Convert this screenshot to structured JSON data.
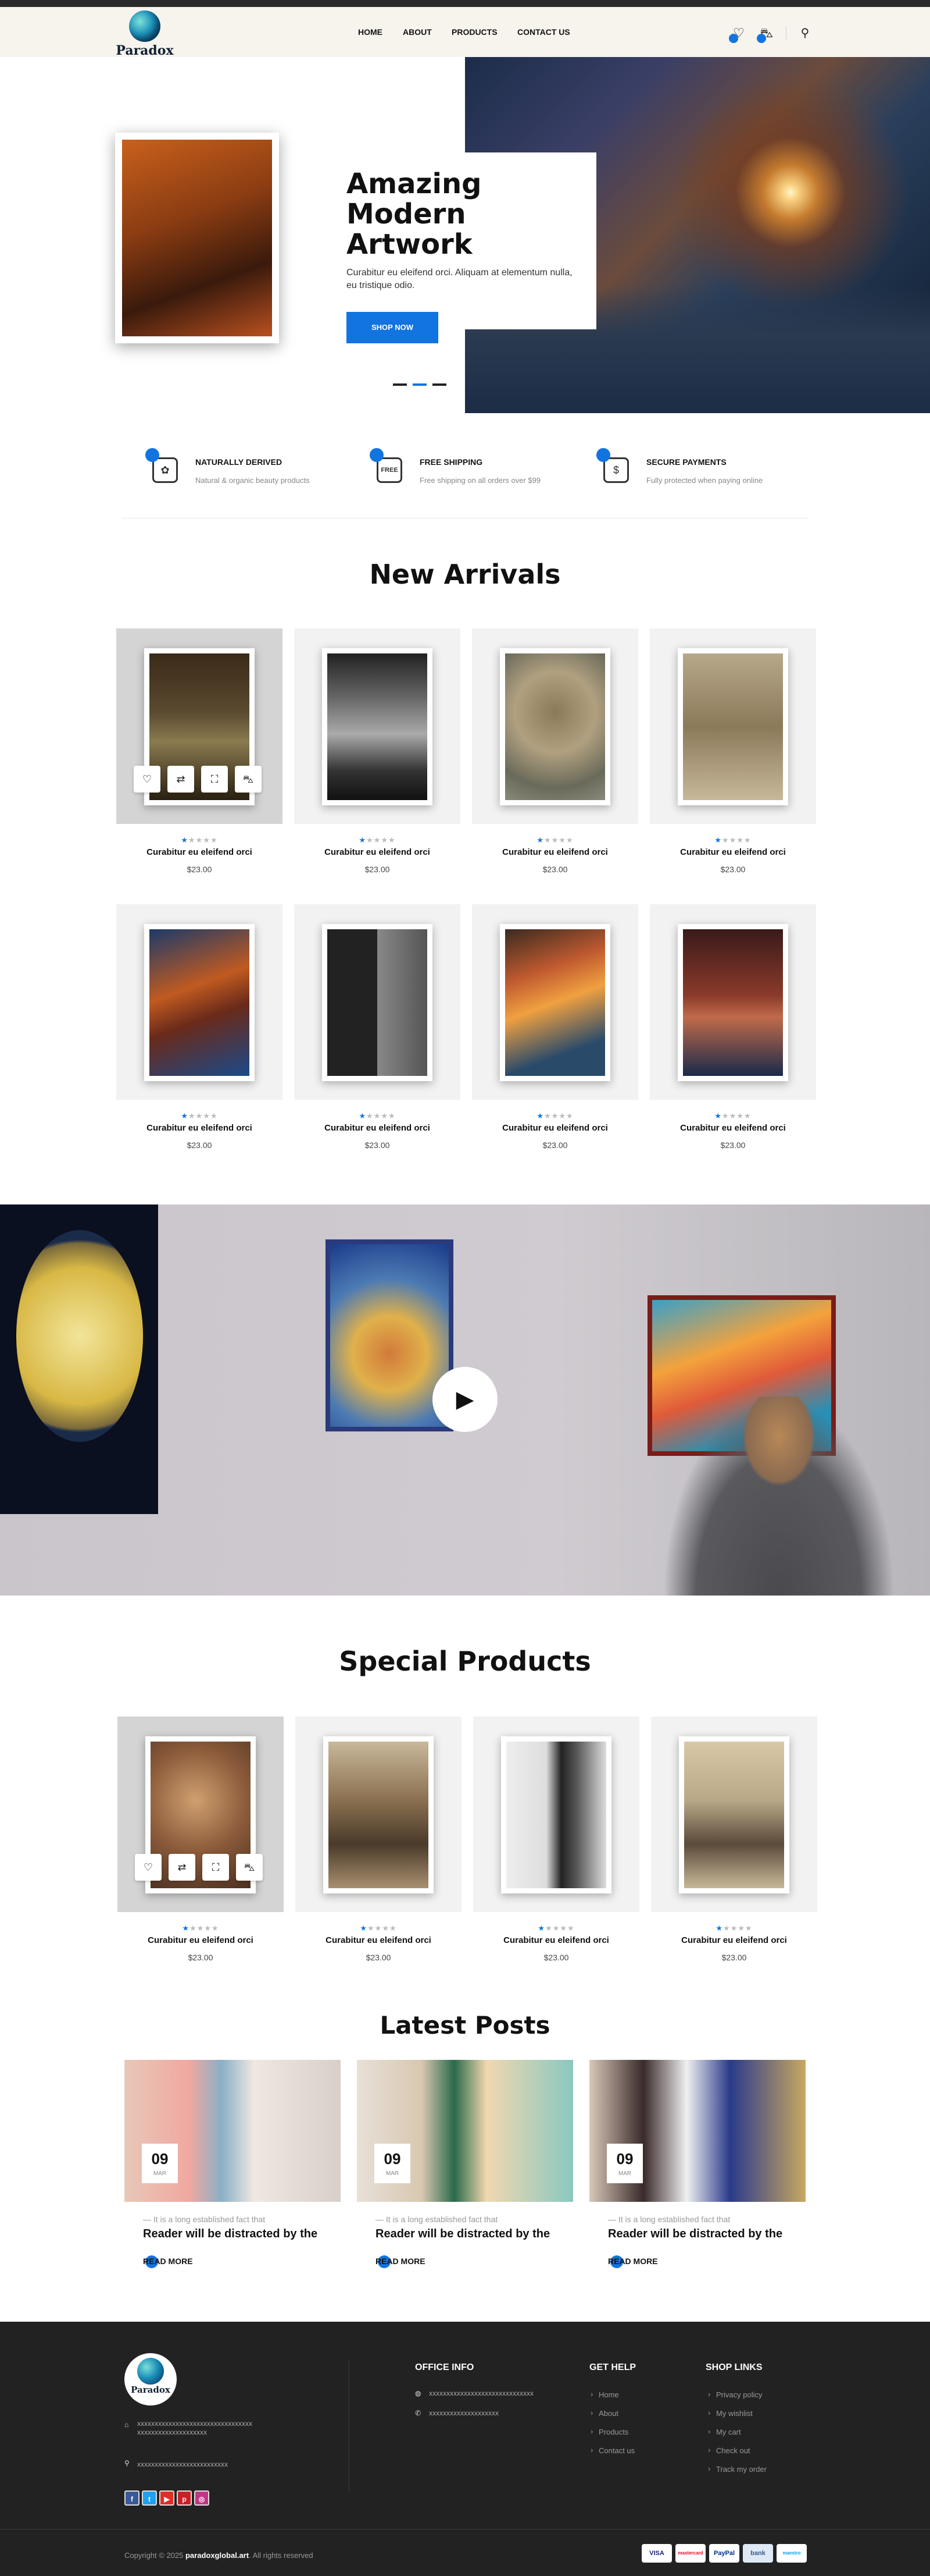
{
  "header": {
    "logo_text": "Paradox",
    "nav": [
      "HOME",
      "ABOUT",
      "PRODUCTS",
      "CONTACT US"
    ],
    "icons": [
      "wishlist-icon",
      "cart-icon",
      "search-icon"
    ]
  },
  "hero": {
    "title_line1": "Amazing",
    "title_line2": "Modern Artwork",
    "text": "Curabitur eu eleifend orci. Aliquam at elementum nulla, eu tristique odio.",
    "button": "SHOP NOW",
    "slide_count": 3,
    "active_slide": 2
  },
  "features": [
    {
      "title": "NATURALLY DERIVED",
      "subtitle": "Natural & organic beauty products",
      "icon": "natural-icon",
      "glyph": "✿"
    },
    {
      "title": "FREE SHIPPING",
      "subtitle": "Free shipping on all orders over $99",
      "icon": "truck-icon",
      "glyph": "FREE"
    },
    {
      "title": "SECURE PAYMENTS",
      "subtitle": "Fully protected when paying online",
      "icon": "secure-hand-icon",
      "glyph": "$"
    }
  ],
  "new_arrivals": {
    "title": "New Arrivals",
    "products": [
      {
        "name": "Curabitur eu eleifend orci",
        "price": "$23.00",
        "rating": 1
      },
      {
        "name": "Curabitur eu eleifend orci",
        "price": "$23.00",
        "rating": 1
      },
      {
        "name": "Curabitur eu eleifend orci",
        "price": "$23.00",
        "rating": 1
      },
      {
        "name": "Curabitur eu eleifend orci",
        "price": "$23.00",
        "rating": 1
      },
      {
        "name": "Curabitur eu eleifend orci",
        "price": "$23.00",
        "rating": 1
      },
      {
        "name": "Curabitur eu eleifend orci",
        "price": "$23.00",
        "rating": 1
      },
      {
        "name": "Curabitur eu eleifend orci",
        "price": "$23.00",
        "rating": 1
      },
      {
        "name": "Curabitur eu eleifend orci",
        "price": "$23.00",
        "rating": 1
      }
    ]
  },
  "card_actions": [
    "heart-icon",
    "compare-icon",
    "quickview-icon",
    "cart-icon"
  ],
  "special_products": {
    "title": "Special Products",
    "products": [
      {
        "name": "Curabitur eu eleifend orci",
        "price": "$23.00",
        "rating": 1
      },
      {
        "name": "Curabitur eu eleifend orci",
        "price": "$23.00",
        "rating": 1
      },
      {
        "name": "Curabitur eu eleifend orci",
        "price": "$23.00",
        "rating": 1
      },
      {
        "name": "Curabitur eu eleifend orci",
        "price": "$23.00",
        "rating": 1
      }
    ]
  },
  "latest_posts": {
    "title": "Latest Posts",
    "posts": [
      {
        "day": "09",
        "month": "MAR",
        "excerpt": "— It is a long established fact that",
        "title": "Reader will be distracted by the",
        "link": "READ MORE"
      },
      {
        "day": "09",
        "month": "MAR",
        "excerpt": "— It is a long established fact that",
        "title": "Reader will be distracted by the",
        "link": "READ MORE"
      },
      {
        "day": "09",
        "month": "MAR",
        "excerpt": "— It is a long established fact that",
        "title": "Reader will be distracted by the",
        "link": "READ MORE"
      }
    ]
  },
  "footer": {
    "logo_text": "Paradox",
    "address": "xxxxxxxxxxxxxxxxxxxxxxxxxxxxxxxxx xxxxxxxxxxxxxxxxxxxx",
    "location": "xxxxxxxxxxxxxxxxxxxxxxxxxx",
    "office_title": "OFFICE INFO",
    "office_email": "xxxxxxxxxxxxxxxxxxxxxxxxxxxxxx",
    "office_phone": "xxxxxxxxxxxxxxxxxxxx",
    "help_title": "GET HELP",
    "help_links": [
      "Home",
      "About",
      "Products",
      "Contact us"
    ],
    "shop_title": "SHOP LINKS",
    "shop_links": [
      "Privacy policy",
      "My wishlist",
      "My cart",
      "Check out",
      "Track my order"
    ],
    "social": [
      "facebook-icon",
      "twitter-icon",
      "youtube-icon",
      "pinterest-icon",
      "instagram-icon"
    ],
    "copyright_prefix": "Copyright © 2025 ",
    "copyright_site": "paradoxglobal.art",
    "copyright_suffix": ". All rights reserved",
    "payments": [
      "VISA",
      "mastercard",
      "PayPal",
      "bank",
      "maestro"
    ]
  },
  "colors": {
    "accent": "#1274e0",
    "footer_bg": "#222222",
    "header_bg": "#f7f4ee"
  }
}
